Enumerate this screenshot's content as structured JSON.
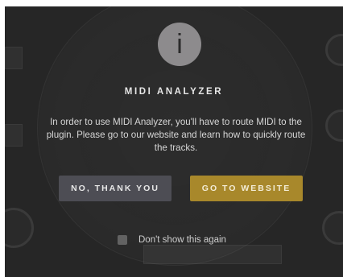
{
  "dialog": {
    "icon": "info-icon",
    "icon_glyph": "i",
    "title": "MIDI ANALYZER",
    "message": "In order to use MIDI Analyzer, you'll have to route MIDI to the plugin. Please go to our website and learn how to quickly route the tracks.",
    "decline_label": "NO, THANK YOU",
    "accept_label": "GO TO WEBSITE",
    "dont_show_label": "Don't show this again",
    "dont_show_checked": false
  },
  "colors": {
    "backdrop": "#262626",
    "icon_circle": "#8d8b8d",
    "secondary_button": "#4d4d54",
    "primary_button": "#a8882b"
  }
}
